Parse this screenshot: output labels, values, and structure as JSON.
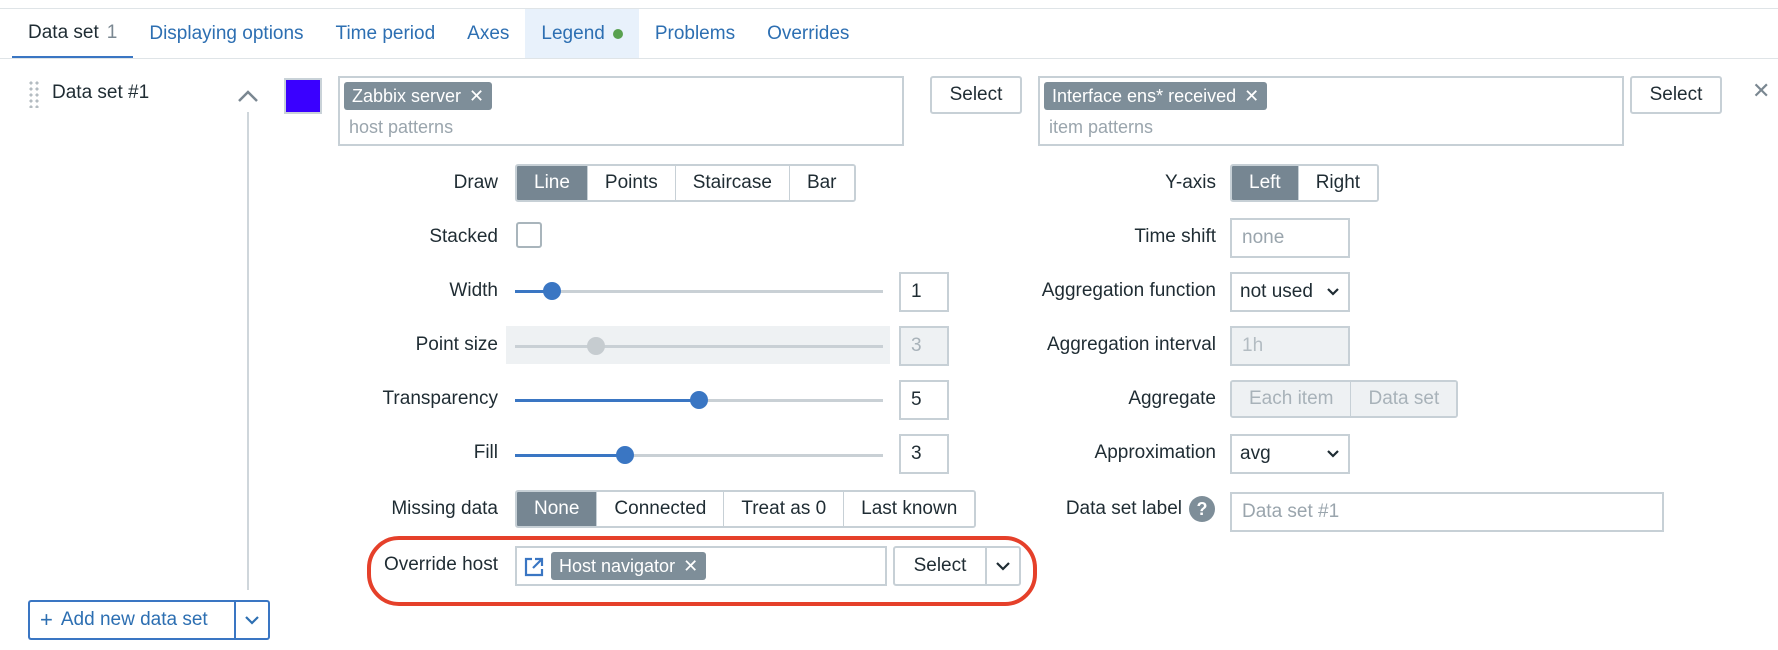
{
  "tabs": [
    {
      "label": "Data set",
      "count": "1",
      "active": true
    },
    {
      "label": "Displaying options"
    },
    {
      "label": "Time period"
    },
    {
      "label": "Axes"
    },
    {
      "label": "Legend",
      "indicator": true
    },
    {
      "label": "Problems"
    },
    {
      "label": "Overrides"
    }
  ],
  "dataset": {
    "title": "Data set #1",
    "color": "#3a00ff",
    "hosts": {
      "tag": "Zabbix server",
      "placeholder": "host patterns",
      "select_label": "Select"
    },
    "items": {
      "tag": "Interface ens* received",
      "placeholder": "item patterns",
      "select_label": "Select"
    }
  },
  "left_form": {
    "draw": {
      "label": "Draw",
      "options": [
        "Line",
        "Points",
        "Staircase",
        "Bar"
      ],
      "selected": "Line"
    },
    "stacked": {
      "label": "Stacked",
      "checked": false
    },
    "width": {
      "label": "Width",
      "value": "1",
      "fraction": 0.1
    },
    "point_size": {
      "label": "Point size",
      "value": "3",
      "fraction": 0.22,
      "disabled": true
    },
    "transparency": {
      "label": "Transparency",
      "value": "5",
      "fraction": 0.5
    },
    "fill": {
      "label": "Fill",
      "value": "3",
      "fraction": 0.3
    },
    "missing_data": {
      "label": "Missing data",
      "options": [
        "None",
        "Connected",
        "Treat as 0",
        "Last known"
      ],
      "selected": "None"
    },
    "override_host": {
      "label": "Override host",
      "tag": "Host navigator",
      "select_label": "Select"
    }
  },
  "right_form": {
    "y_axis": {
      "label": "Y-axis",
      "options": [
        "Left",
        "Right"
      ],
      "selected": "Left"
    },
    "time_shift": {
      "label": "Time shift",
      "placeholder": "none"
    },
    "aggregation_function": {
      "label": "Aggregation function",
      "value": "not used"
    },
    "aggregation_interval": {
      "label": "Aggregation interval",
      "placeholder": "1h"
    },
    "aggregate": {
      "label": "Aggregate",
      "options": [
        "Each item",
        "Data set"
      ]
    },
    "approximation": {
      "label": "Approximation",
      "value": "avg"
    },
    "data_set_label": {
      "label": "Data set label",
      "placeholder": "Data set #1"
    }
  },
  "add_button": {
    "label": "Add new data set"
  },
  "colors": {
    "accent": "#3a76c3",
    "highlight": "#e5402a",
    "legend_dot": "#59a14f"
  }
}
